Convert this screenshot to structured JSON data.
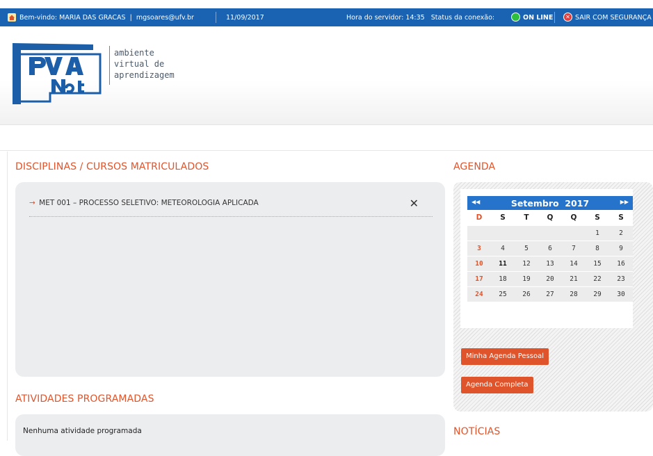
{
  "topbar": {
    "welcome": "Bem-vindo: MARIA DAS GRACAS",
    "email": "mgsoares@ufv.br",
    "date": "11/09/2017",
    "server_time": "Hora do servidor: 14:35",
    "status_label": "Status da conexão:",
    "status": "ON LINE",
    "logout": "SAIR COM SEGURANÇA"
  },
  "logo": {
    "line1": "ambiente",
    "line2": "virtual de",
    "line3": "aprendizagem"
  },
  "courses": {
    "title": "DISCIPLINAS / CURSOS MATRICULADOS",
    "items": [
      {
        "label": "MET 001 – PROCESSO SELETIVO: METEOROLOGIA APLICADA"
      }
    ]
  },
  "activities": {
    "title": "ATIVIDADES PROGRAMADAS",
    "empty": "Nenhuma atividade programada"
  },
  "agenda": {
    "title": "AGENDA",
    "month": "Setembro",
    "year": "2017",
    "weekdays": [
      "D",
      "S",
      "T",
      "Q",
      "Q",
      "S",
      "S"
    ],
    "weeks": [
      [
        "",
        "",
        "",
        "",
        "",
        "1",
        "2"
      ],
      [
        "3",
        "4",
        "5",
        "6",
        "7",
        "8",
        "9"
      ],
      [
        "10",
        "11",
        "12",
        "13",
        "14",
        "15",
        "16"
      ],
      [
        "17",
        "18",
        "19",
        "20",
        "21",
        "22",
        "23"
      ],
      [
        "24",
        "25",
        "26",
        "27",
        "28",
        "29",
        "30"
      ]
    ],
    "today": "11",
    "personal_button": "Minha Agenda Pessoal",
    "full_button": "Agenda Completa"
  },
  "news": {
    "title": "NOTÍCIAS"
  },
  "colors": {
    "topbar": "#1a62b2",
    "accent": "#e0542b",
    "calendar_header": "#2673cc"
  }
}
